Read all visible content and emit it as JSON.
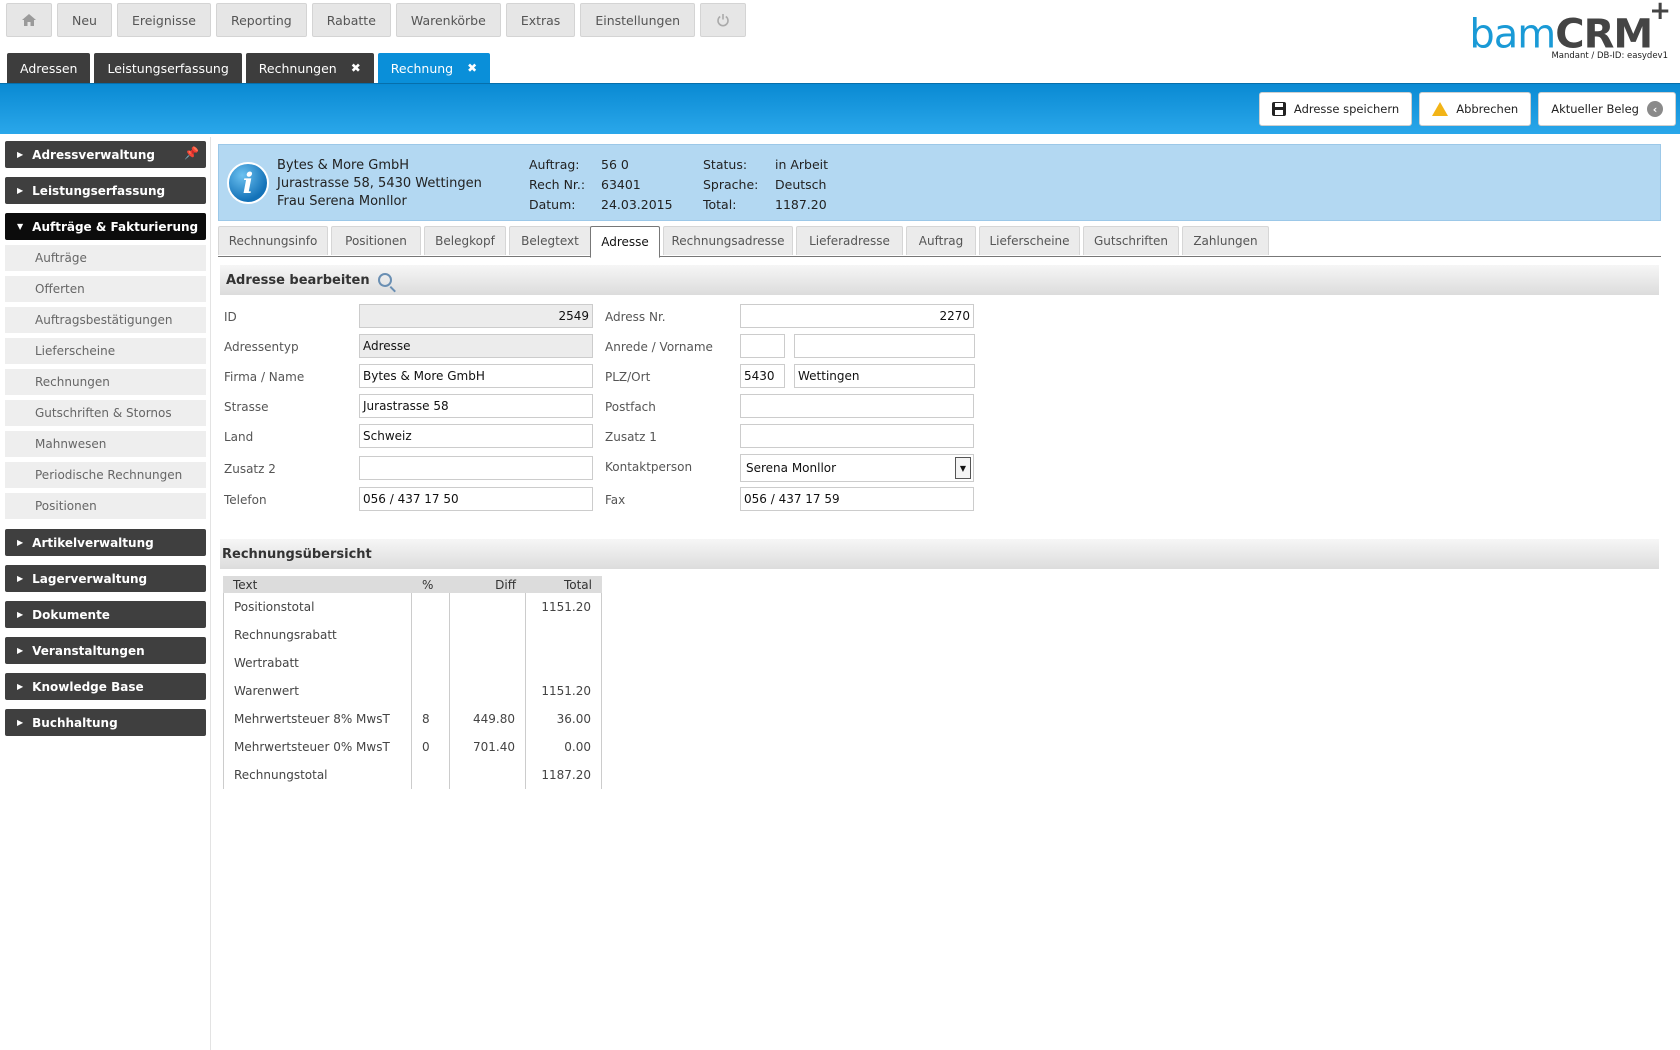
{
  "topnav": {
    "home_icon": "home-icon",
    "items": [
      "Neu",
      "Ereignisse",
      "Reporting",
      "Rabatte",
      "Warenkörbe",
      "Extras",
      "Einstellungen"
    ],
    "power_icon": "power-icon"
  },
  "logo": {
    "brand_light": "bam",
    "brand_bold": "CRM",
    "plus": "+",
    "mandant": "Mandant / DB-ID: easydev1"
  },
  "doctabs": [
    {
      "label": "Adressen",
      "closable": false
    },
    {
      "label": "Leistungserfassung",
      "closable": false
    },
    {
      "label": "Rechnungen",
      "closable": true
    },
    {
      "label": "Rechnung",
      "closable": true,
      "active": true
    }
  ],
  "close_glyph": "✖",
  "actions": {
    "save": "Adresse speichern",
    "cancel": "Abbrechen",
    "current": "Aktueller Beleg"
  },
  "sidebar": {
    "groups": [
      {
        "label": "Adressverwaltung",
        "pin": true
      },
      {
        "label": "Leistungserfassung"
      },
      {
        "label": "Aufträge & Fakturierung",
        "open": true,
        "items": [
          "Aufträge",
          "Offerten",
          "Auftragsbestätigungen",
          "Lieferscheine",
          "Rechnungen",
          "Gutschriften & Stornos",
          "Mahnwesen",
          "Periodische Rechnungen",
          "Positionen"
        ]
      },
      {
        "label": "Artikelverwaltung"
      },
      {
        "label": "Lagerverwaltung"
      },
      {
        "label": "Dokumente"
      },
      {
        "label": "Veranstaltungen"
      },
      {
        "label": "Knowledge Base"
      },
      {
        "label": "Buchhaltung"
      }
    ]
  },
  "info": {
    "icon_glyph": "i",
    "company": "Bytes & More GmbH",
    "street": "Jurastrasse 58, 5430 Wettingen",
    "contact": "Frau Serena Monllor",
    "auftrag_label": "Auftrag:",
    "auftrag": "56 0",
    "rech_label": "Rech Nr.:",
    "rech": "63401",
    "datum_label": "Datum:",
    "datum": "24.03.2015",
    "status_label": "Status:",
    "status": "in Arbeit",
    "sprache_label": "Sprache:",
    "sprache": "Deutsch",
    "total_label": "Total:",
    "total": "1187.20"
  },
  "subtabs": [
    "Rechnungsinfo",
    "Positionen",
    "Belegkopf",
    "Belegtext",
    "Adresse",
    "Rechnungsadresse",
    "Lieferadresse",
    "Auftrag",
    "Lieferscheine",
    "Gutschriften",
    "Zahlungen"
  ],
  "form": {
    "title": "Adresse bearbeiten",
    "id_label": "ID",
    "id": "2549",
    "adressnr_label": "Adress Nr.",
    "adressnr": "2270",
    "typ_label": "Adressentyp",
    "typ": "Adresse",
    "anrede_label": "Anrede / Vorname",
    "anrede": "",
    "vorname": "",
    "firma_label": "Firma / Name",
    "firma": "Bytes & More GmbH",
    "plzort_label": "PLZ/Ort",
    "plz": "5430",
    "ort": "Wettingen",
    "strasse_label": "Strasse",
    "strasse": "Jurastrasse 58",
    "postfach_label": "Postfach",
    "postfach": "",
    "land_label": "Land",
    "land": "Schweiz",
    "zusatz1_label": "Zusatz 1",
    "zusatz1": "",
    "zusatz2_label": "Zusatz 2",
    "zusatz2": "",
    "kontakt_label": "Kontaktperson",
    "kontakt": "Serena Monllor",
    "telefon_label": "Telefon",
    "telefon": "056 / 437 17 50",
    "fax_label": "Fax",
    "fax": "056 / 437 17 59"
  },
  "summary": {
    "title": "Rechnungsübersicht",
    "headers": [
      "Text",
      "%",
      "Diff",
      "Total"
    ],
    "rows": [
      [
        "Positionstotal",
        "",
        "",
        "1151.20"
      ],
      [
        "Rechnungsrabatt",
        "",
        "",
        ""
      ],
      [
        "Wertrabatt",
        "",
        "",
        ""
      ],
      [
        "Warenwert",
        "",
        "",
        "1151.20"
      ],
      [
        "Mehrwertsteuer 8% MwsT",
        "8",
        "449.80",
        "36.00"
      ],
      [
        "Mehrwertsteuer 0% MwsT",
        "0",
        "701.40",
        "0.00"
      ],
      [
        "Rechnungstotal",
        "",
        "",
        "1187.20"
      ]
    ]
  }
}
